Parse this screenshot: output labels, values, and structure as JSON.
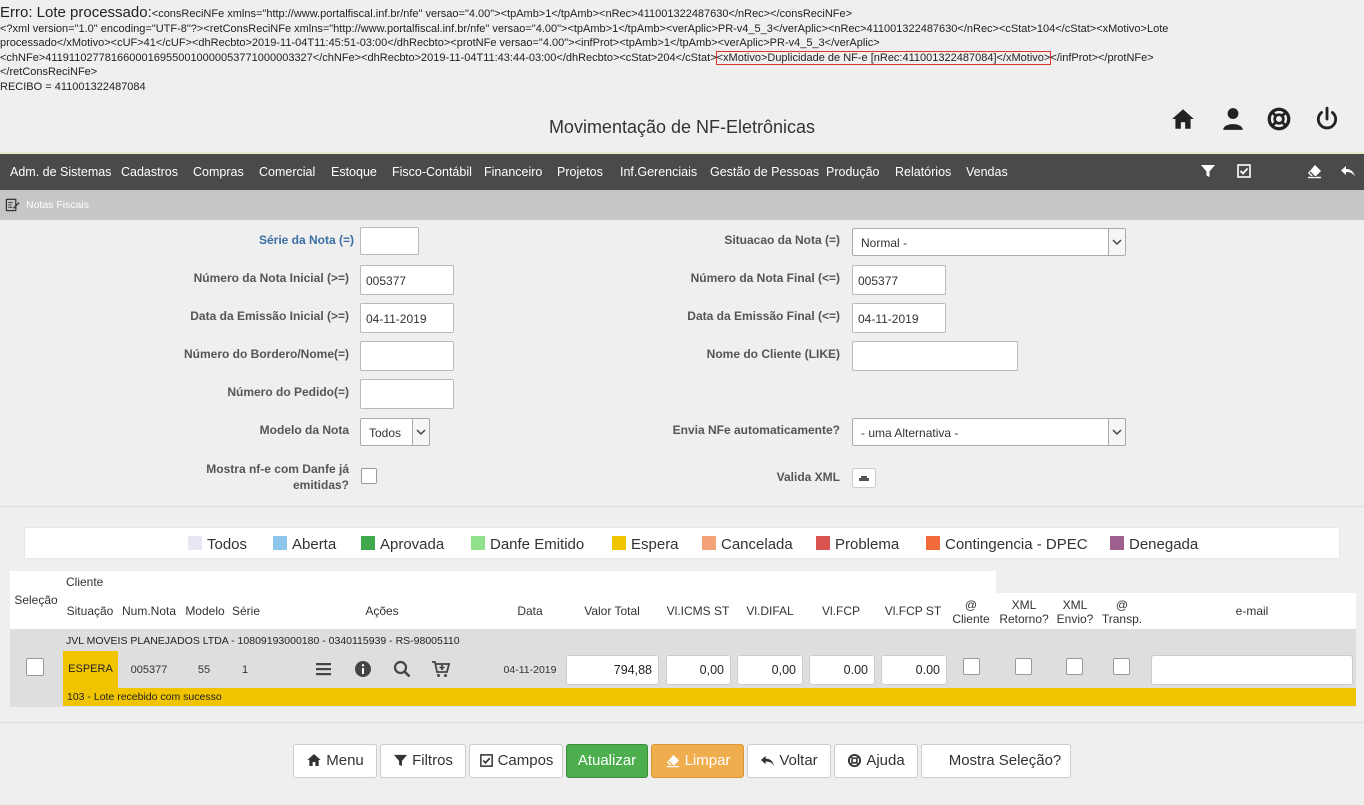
{
  "error": {
    "prefix": "Erro: Lote processado:",
    "line1_rest": "<consReciNFe xmlns=\"http://www.portalfiscal.inf.br/nfe\" versao=\"4.00\"><tpAmb>1</tpAmb><nRec>411001322487630</nRec></consReciNFe>",
    "line2": "<?xml version=\"1.0\" encoding=\"UTF-8\"?><retConsReciNFe xmlns=\"http://www.portalfiscal.inf.br/nfe\" versao=\"4.00\"><tpAmb>1</tpAmb><verAplic>PR-v4_5_3</verAplic><nRec>411001322487630</nRec><cStat>104</cStat><xMotivo>Lote",
    "line3": "processado</xMotivo><cUF>41</cUF><dhRecbto>2019-11-04T11:45:51-03:00</dhRecbto><protNFe versao=\"4.00\"><infProt><tpAmb>1</tpAmb><verAplic>PR-v4_5_3</verAplic>",
    "line4_a": "<chNFe>41191102778166000169550010000053771000003327</chNFe><dhRecbto>2019-11-04T11:43:44-03:00</dhRecbto><cStat>204</cStat>",
    "line4_highlight": "<xMotivo>Duplicidade de NF-e [nRec:411001322487084]</xMotivo>",
    "line4_b": "</infProt></protNFe>",
    "line5": "</retConsReciNFe>",
    "line6": "RECIBO = 411001322487084"
  },
  "page_title": "Movimentação de NF-Eletrônicas",
  "top_icons": [
    "home-icon",
    "user-icon",
    "help-lifebuoy-icon",
    "power-icon"
  ],
  "menu": [
    "Adm. de Sistemas",
    "Cadastros",
    "Compras",
    "Comercial",
    "Estoque",
    "Fisco-Contábil",
    "Financeiro",
    "Projetos",
    "Inf.Gerenciais",
    "Gestão de Pessoas",
    "Produção",
    "Relatórios",
    "Vendas"
  ],
  "menu_right_icons": [
    "filter-icon",
    "checkbox-icon",
    "eraser-icon",
    "undo-icon"
  ],
  "breadcrumb": "Notas Fiscais",
  "filters": {
    "serie_label": "Série da Nota (=)",
    "serie_value": "",
    "situacao_label": "Situacao da Nota (=)",
    "situacao_value": "Normal -",
    "num_inicial_label": "Número da Nota Inicial (>=)",
    "num_inicial_value": "005377",
    "num_final_label": "Número da Nota Final (<=)",
    "num_final_value": "005377",
    "data_inicial_label": "Data da Emissão Inicial (>=)",
    "data_inicial_value": "04-11-2019",
    "data_final_label": "Data da Emissão Final (<=)",
    "data_final_value": "04-11-2019",
    "bordero_label": "Número do Bordero/Nome(=)",
    "bordero_value": "",
    "cliente_label": "Nome do Cliente (LIKE)",
    "cliente_value": "",
    "pedido_label": "Número do Pedido(=)",
    "pedido_value": "",
    "modelo_label": "Modelo da Nota",
    "modelo_value": "Todos",
    "envia_label": "Envia NFe automaticamente?",
    "envia_value": "- uma Alternativa -",
    "mostra_label_1": "Mostra nf-e com Danfe já",
    "mostra_label_2": "emitidas?",
    "valida_label": "Valida XML"
  },
  "legend": [
    {
      "label": "Todos",
      "color": "#e8e6f2"
    },
    {
      "label": "Aberta",
      "color": "#8ec7ee"
    },
    {
      "label": "Aprovada",
      "color": "#3fa84a"
    },
    {
      "label": "Danfe Emitido",
      "color": "#90e08c"
    },
    {
      "label": "Espera",
      "color": "#f0c400"
    },
    {
      "label": "Cancelada",
      "color": "#f3a27a"
    },
    {
      "label": "Problema",
      "color": "#d9534f"
    },
    {
      "label": "Contingencia - DPEC",
      "color": "#f26a3a"
    },
    {
      "label": "Denegada",
      "color": "#a0608f"
    }
  ],
  "table": {
    "headers": {
      "selecao": "Seleção",
      "cliente": "Cliente",
      "situacao": "Situação",
      "num_nota": "Num.Nota",
      "modelo": "Modelo",
      "serie": "Série",
      "acoes": "Ações",
      "data": "Data",
      "valor_total": "Valor Total",
      "vl_icms_st": "Vl.ICMS ST",
      "vl_difal": "Vl.DIFAL",
      "vl_fcp": "Vl.FCP",
      "vl_fcp_st": "Vl.FCP ST",
      "at_cliente_1": "@",
      "at_cliente_2": "Cliente",
      "xml_retorno_1": "XML",
      "xml_retorno_2": "Retorno?",
      "xml_envio_1": "XML",
      "xml_envio_2": "Envio?",
      "at_transp_1": "@",
      "at_transp_2": "Transp.",
      "email": "e-mail"
    },
    "row": {
      "cliente": "JVL MOVEIS PLANEJADOS LTDA - 10809193000180 - 0340115939 - RS-98005110",
      "situacao": "ESPERA",
      "num_nota": "005377",
      "modelo": "55",
      "serie": "1",
      "data": "04-11-2019",
      "valor_total": "794,88",
      "vl_icms_st": "0,00",
      "vl_difal": "0,00",
      "vl_fcp": "0.00",
      "vl_fcp_st": "0.00",
      "email": "",
      "status_msg": "103 - Lote recebido com sucesso",
      "status_color": "#f0c400"
    }
  },
  "buttons": {
    "menu": "Menu",
    "filtros": "Filtros",
    "campos": "Campos",
    "atualizar": "Atualizar",
    "limpar": "Limpar",
    "voltar": "Voltar",
    "ajuda": "Ajuda",
    "mostra_selecao": "Mostra Seleção?"
  }
}
